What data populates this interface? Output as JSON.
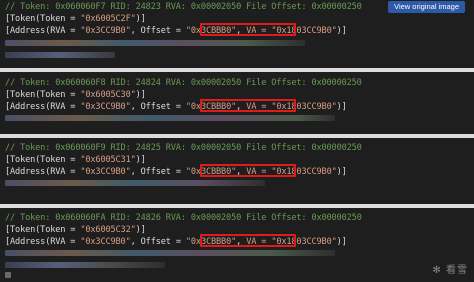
{
  "button": {
    "view_original": "View original image"
  },
  "blocks": [
    {
      "comment": "// Token: 0x060060F7 RID: 24823 RVA: 0x00002050 File Offset: 0x00000250",
      "token": "\"0x6005C2F\"",
      "rva": "\"0x3CC9B0\"",
      "offset": "\"0x3CBBB0\"",
      "va": "\"0x1803CC9B0\""
    },
    {
      "comment": "// Token: 0x060060F8 RID: 24824 RVA: 0x00002050 File Offset: 0x00000250",
      "token": "\"0x6005C30\"",
      "rva": "\"0x3CC9B0\"",
      "offset": "\"0x3CBBB0\"",
      "va": "\"0x1803CC9B0\""
    },
    {
      "comment": "// Token: 0x060060F9 RID: 24825 RVA: 0x00002050 File Offset: 0x00000250",
      "token": "\"0x6005C31\"",
      "rva": "\"0x3CC9B0\"",
      "offset": "\"0x3CBBB0\"",
      "va": "\"0x1803CC9B0\""
    },
    {
      "comment": "// Token: 0x060060FA RID: 24826 RVA: 0x00002050 File Offset: 0x00000250",
      "token": "\"0x6005C32\"",
      "rva": "\"0x3CC9B0\"",
      "offset": "\"0x3CBBB0\"",
      "va": "\"0x1803CC9B0\""
    }
  ],
  "labels": {
    "token_open": "[Token(Token = ",
    "token_close": ")]",
    "address_open": "[Address(RVA = ",
    "offset_sep": ", Offset = ",
    "comma": ", ",
    "va_prefix": "VA = ",
    "address_close": ")]"
  },
  "colors": {
    "background": "#1e1e1e",
    "comment": "#6a9955",
    "attribute": "#4ec9b0",
    "string": "#d69d85",
    "highlight_box": "#e01b1b",
    "separator": "#dcdcdc",
    "button": "#2d5aa6"
  },
  "watermark": {
    "icon": "snowflake-icon",
    "text": "看雪"
  }
}
